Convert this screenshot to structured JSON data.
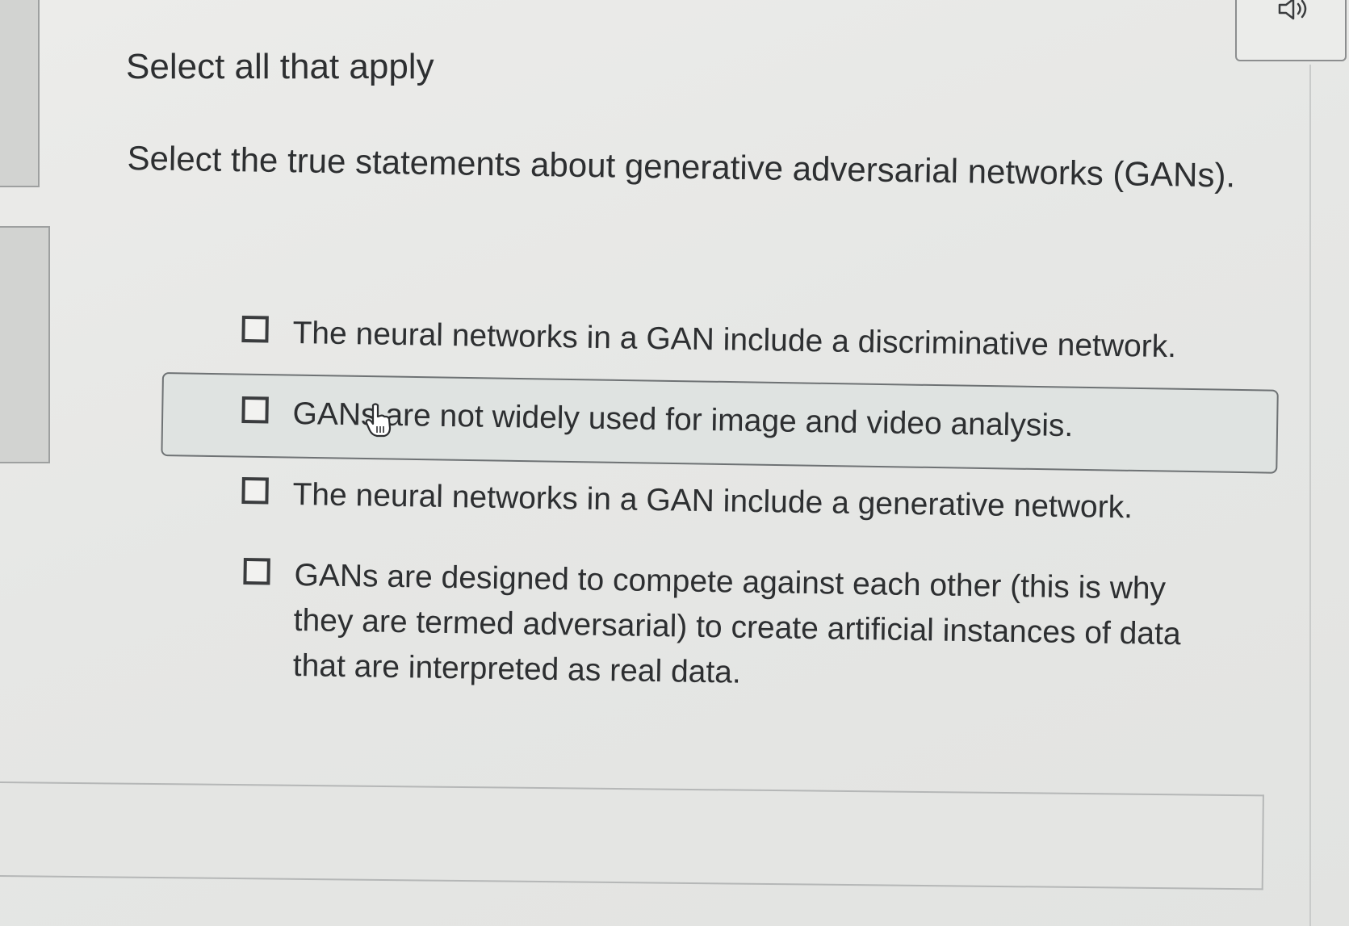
{
  "instruction": "Select all that apply",
  "question": "Select the true statements about generative adversarial networks (GANs).",
  "options": [
    {
      "label": "The neural networks in a GAN include a discriminative network.",
      "checked": false
    },
    {
      "label": "GANs are not widely used for image and video analysis.",
      "checked": false,
      "hovered": true
    },
    {
      "label": "The neural networks in a GAN include a generative network.",
      "checked": false
    },
    {
      "label": "GANs are designed to compete against each other (this is why they are termed adversarial) to create artificial instances of data that are interpreted as real data.",
      "checked": false
    }
  ],
  "icons": {
    "audio": "speaker-icon",
    "cursor": "hand-pointer-icon"
  },
  "colors": {
    "text": "#2d2f31",
    "hover_background": "#dfe3e1",
    "border": "#6e7274"
  }
}
